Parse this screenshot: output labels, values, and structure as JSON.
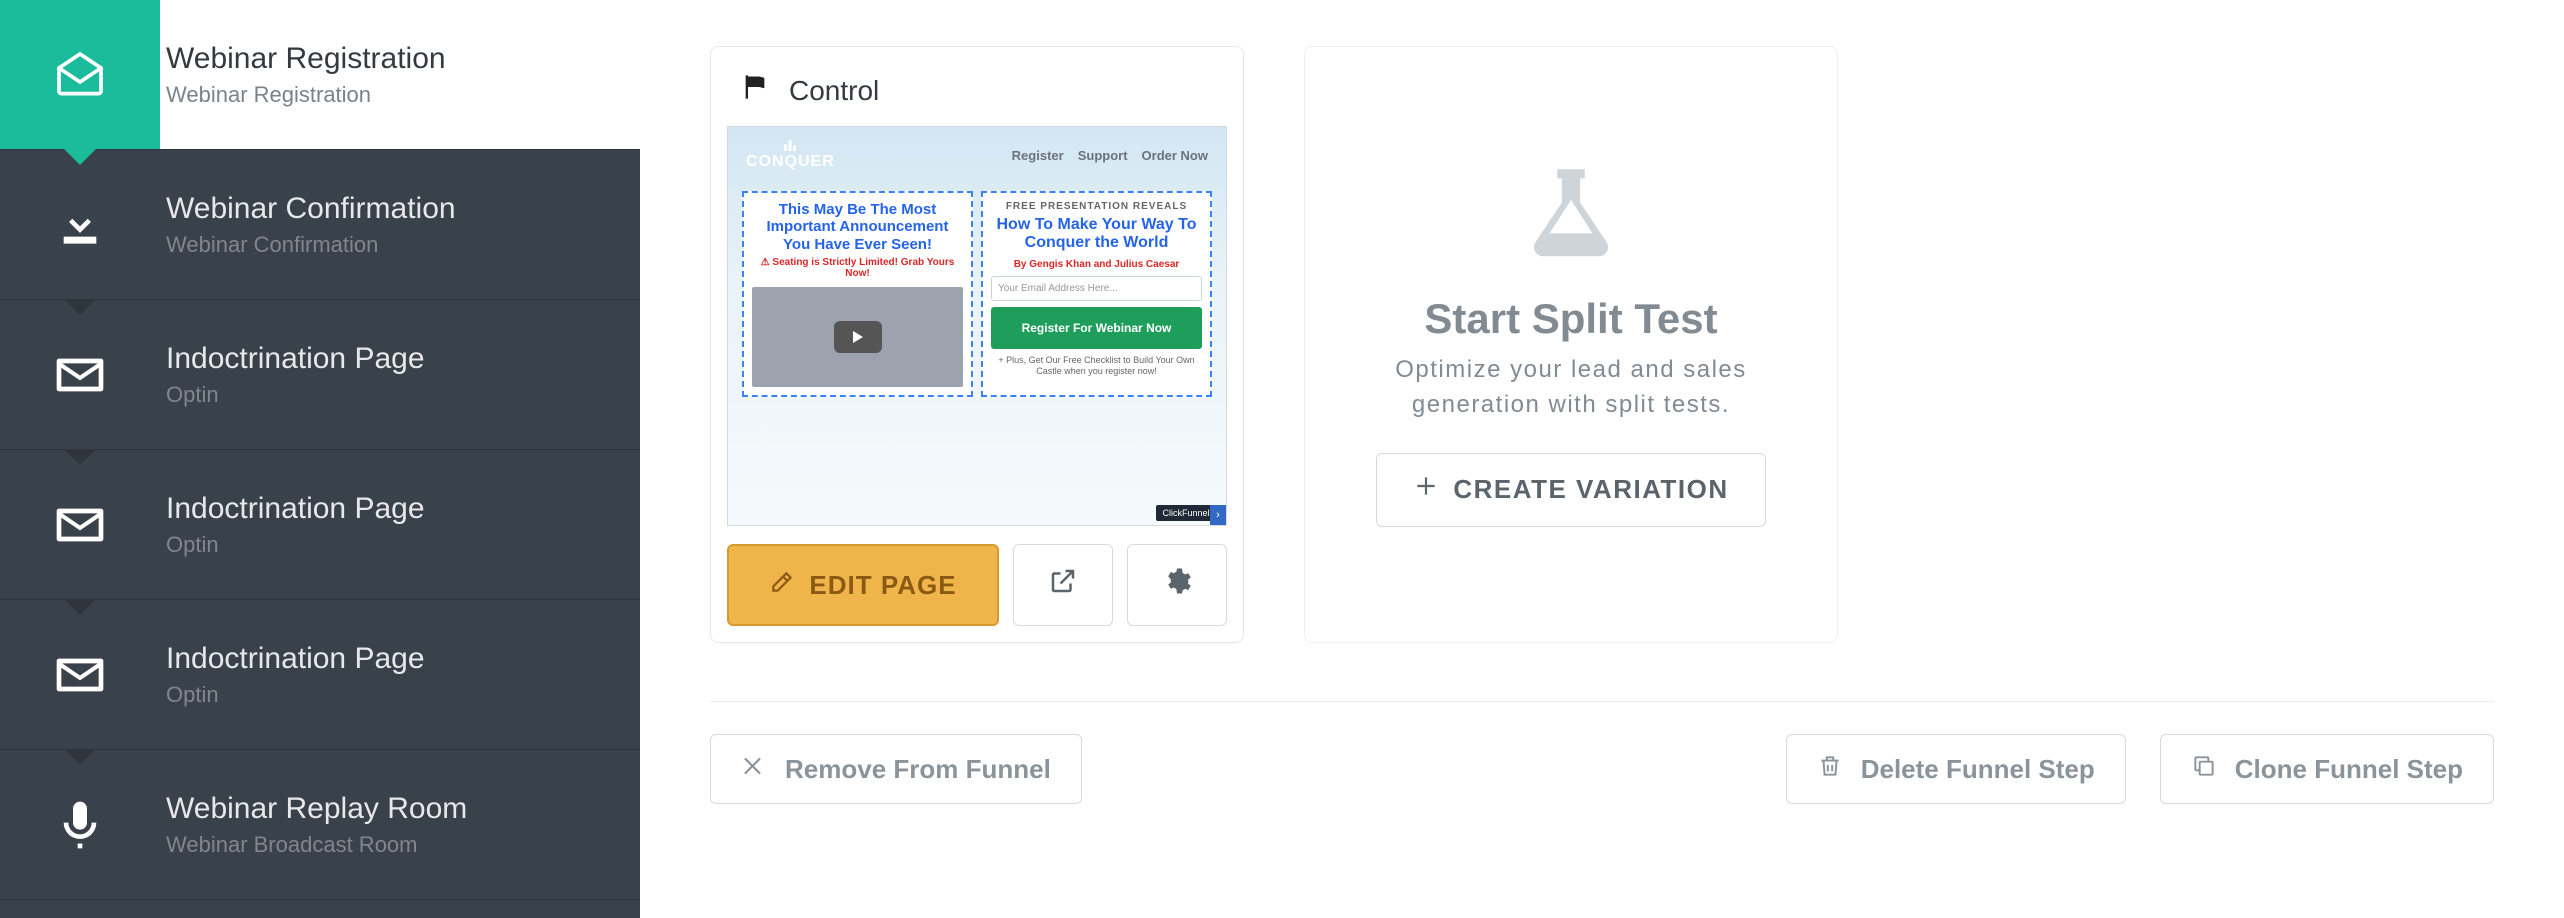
{
  "sidebar": {
    "items": [
      {
        "title": "Webinar Registration",
        "sub": "Webinar Registration",
        "icon": "envelope-open-icon",
        "active": true
      },
      {
        "title": "Webinar Confirmation",
        "sub": "Webinar Confirmation",
        "icon": "download-icon",
        "active": false
      },
      {
        "title": "Indoctrination Page",
        "sub": "Optin",
        "icon": "envelope-icon",
        "active": false
      },
      {
        "title": "Indoctrination Page",
        "sub": "Optin",
        "icon": "envelope-icon",
        "active": false
      },
      {
        "title": "Indoctrination Page",
        "sub": "Optin",
        "icon": "envelope-icon",
        "active": false
      },
      {
        "title": "Webinar Replay Room",
        "sub": "Webinar Broadcast Room",
        "icon": "microphone-icon",
        "active": false
      }
    ]
  },
  "control_card": {
    "label": "Control",
    "edit_label": "EDIT PAGE",
    "preview": {
      "logo": "CONQUER",
      "nav": [
        "Register",
        "Support",
        "Order Now"
      ],
      "left_heading": "This May Be The Most Important Announcement You Have Ever Seen!",
      "left_warning": "⚠ Seating is Strictly Limited! Grab Yours Now!",
      "right_small": "FREE PRESENTATION REVEALS",
      "right_heading": "How To Make Your Way To Conquer the World",
      "right_by": "By Gengis Khan and Julius Caesar",
      "right_placeholder": "Your Email Address Here...",
      "right_button": "Register For Webinar Now",
      "right_foot": "+ Plus, Get Our Free Checklist to Build Your Own Castle when you register now!",
      "powered_by": "ClickFunnels"
    }
  },
  "split": {
    "title": "Start Split Test",
    "desc": "Optimize your lead and sales generation with split tests.",
    "create_label": "CREATE VARIATION"
  },
  "footer": {
    "remove": "Remove From Funnel",
    "delete": "Delete Funnel Step",
    "clone": "Clone Funnel Step"
  }
}
